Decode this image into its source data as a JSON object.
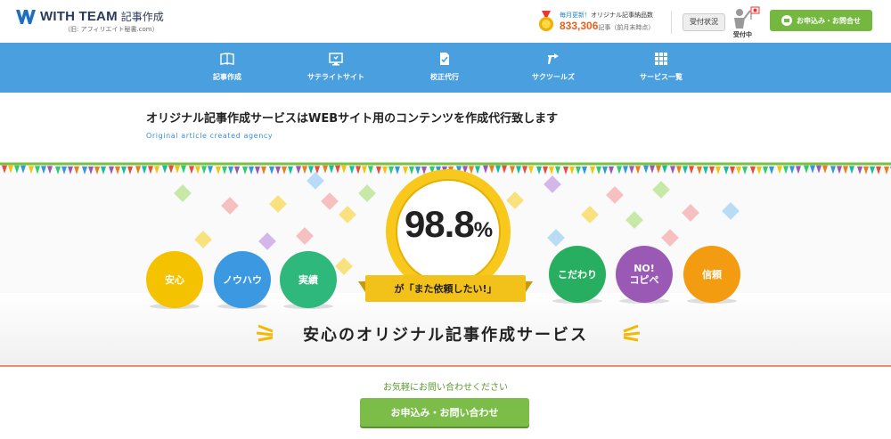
{
  "header": {
    "logo_text": "WITH TEAM",
    "logo_suffix": "記事作成",
    "logo_sub": "（旧: アフィリエイト秘書.com）",
    "stat_prefix": "毎月更新！",
    "stat_label": "オリジナル記事納品数",
    "stat_number": "833,306",
    "stat_unit": "記事",
    "stat_note": "（前月末時点）",
    "status_button": "受付状況",
    "status_label": "受付中",
    "contact_button": "お申込み・お問合せ"
  },
  "nav": {
    "items": [
      {
        "label": "記事作成",
        "icon": "book-icon"
      },
      {
        "label": "サテライトサイト",
        "icon": "monitor-icon"
      },
      {
        "label": "校正代行",
        "icon": "document-check-icon"
      },
      {
        "label": "サクツールズ",
        "icon": "tool-icon"
      },
      {
        "label": "サービス一覧",
        "icon": "grid-icon"
      }
    ]
  },
  "intro": {
    "headline": "オリジナル記事作成サービスはWEBサイト用のコンテンツを作成代行致します",
    "subline": "Original article created agency"
  },
  "hero": {
    "badge_number": "98.8",
    "badge_percent": "%",
    "badge_caption": "が「また依頼したい!」",
    "features_left": [
      {
        "label": "安心",
        "color": "#f5c200"
      },
      {
        "label": "ノウハウ",
        "color": "#3a99e0"
      },
      {
        "label": "実績",
        "color": "#2fb87c"
      }
    ],
    "features_right": [
      {
        "label": "こだわり",
        "color": "#27ae60"
      },
      {
        "label": "NO!\nコピペ",
        "color": "#9b59b6"
      },
      {
        "label": "信頼",
        "color": "#f39c12"
      }
    ],
    "service_title": "安心のオリジナル記事作成サービス"
  },
  "contact": {
    "invite": "お気軽にお問い合わせください",
    "button": "お申込み・お問い合わせ"
  },
  "colors": {
    "nav_bg": "#4a9fde",
    "accent_green": "#7cbc48",
    "badge_yellow": "#f8c81c",
    "stat_orange": "#e8601c"
  }
}
